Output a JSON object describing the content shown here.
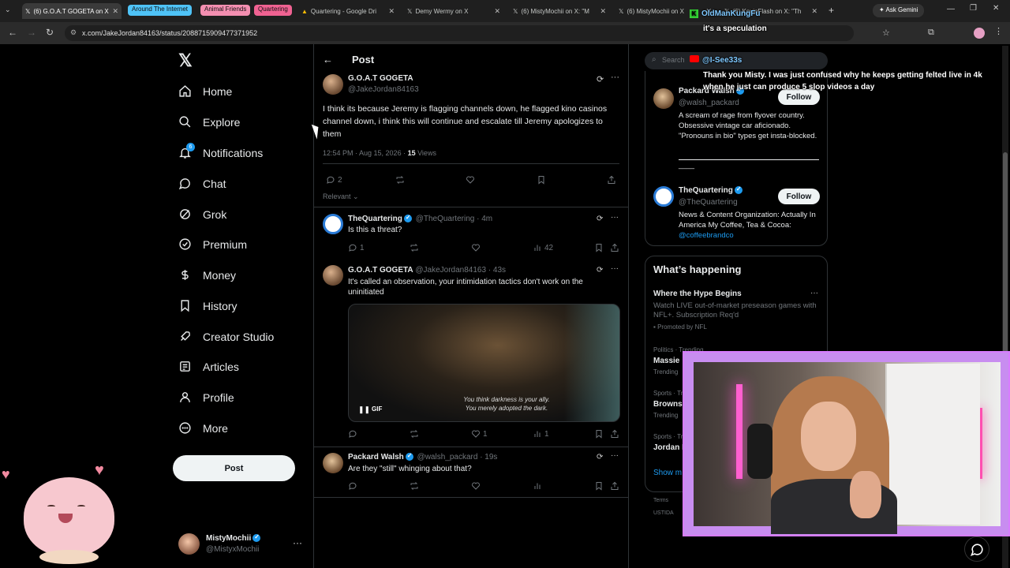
{
  "browser": {
    "tabs": [
      {
        "label": "(6) G.O.A.T GOGETA on X",
        "active": true
      },
      {
        "label": "Around The Internet",
        "group": true,
        "color": "#4fc3f7"
      },
      {
        "label": "Animal Friends",
        "group": true,
        "color": "#f48fb1"
      },
      {
        "label": "Quartering",
        "group": true,
        "color": "#f06292"
      },
      {
        "label": "Quartering - Google Dri"
      },
      {
        "label": "Demy Wermy on X"
      },
      {
        "label": "(6) MistyMochii on X: \"M"
      },
      {
        "label": "(6) MistyMochii on X"
      },
      {
        "label": "(6) KevinFlash on X: \"Th"
      }
    ],
    "ask_gemini": "Ask Gemini",
    "url": "x.com/JakeJordan84163/status/2088715909477371952"
  },
  "sidebar": {
    "items": [
      {
        "label": "Home",
        "icon": "home-icon"
      },
      {
        "label": "Explore",
        "icon": "search-icon"
      },
      {
        "label": "Notifications",
        "icon": "bell-icon"
      },
      {
        "label": "Chat",
        "icon": "chat-icon"
      },
      {
        "label": "Grok",
        "icon": "grok-icon"
      },
      {
        "label": "Premium",
        "icon": "premium-icon"
      },
      {
        "label": "Money",
        "icon": "money-icon"
      },
      {
        "label": "History",
        "icon": "bookmark-icon"
      },
      {
        "label": "Creator Studio",
        "icon": "rocket-icon"
      },
      {
        "label": "Articles",
        "icon": "article-icon"
      },
      {
        "label": "Profile",
        "icon": "person-icon"
      },
      {
        "label": "More",
        "icon": "more-circle-icon"
      }
    ],
    "notification_badge": "6",
    "post_button": "Post",
    "account": {
      "name": "MistyMochii",
      "handle": "@MistyxMochii"
    }
  },
  "header": {
    "title": "Post"
  },
  "main_post": {
    "name": "G.O.A.T GOGETA",
    "handle": "@JakeJordan84163",
    "text": "I think its because Jeremy is flagging channels down, he flagged kino casinos channel down, i think this will continue and escalate till Jeremy apologizes to them",
    "time": "12:54 PM · Aug 15, 2026 · ",
    "views_count": "15",
    "views_label": " Views",
    "replies": "2",
    "sort": "Relevant"
  },
  "replies": [
    {
      "name": "TheQuartering",
      "handle": "@TheQuartering · 4m",
      "text": "Is this a threat?",
      "replies": "1",
      "likes": "",
      "views": "42"
    },
    {
      "name": "G.O.A.T GOGETA",
      "handle": "@JakeJordan84163 · 43s",
      "text": "It's called an observation, your intimidation tactics don't work on the uninitiated",
      "gif_caption_1": "You think darkness is your ally.",
      "gif_caption_2": "You merely adopted the dark.",
      "gif_label": "GIF",
      "replies": "",
      "likes": "1",
      "views": "1"
    },
    {
      "name": "Packard Walsh",
      "handle": "@walsh_packard · 19s",
      "text": "Are they \"still\" whinging about that?"
    }
  ],
  "right": {
    "search_placeholder": "Search",
    "people": [
      {
        "name": "Packard Walsh",
        "handle": "@walsh_packard",
        "bio": "A scream of rage from flyover country. Obsessive vintage car aficionado. \"Pronouns in bio\" types get insta-blocked.",
        "extra": "____",
        "follow": "Follow"
      },
      {
        "name": "TheQuartering",
        "handle": "@TheQuartering",
        "bio": "News & Content Organization: Actually In America My Coffee, Tea & Cocoa:",
        "link": "@coffeebrandco",
        "follow": "Follow"
      }
    ],
    "whats_happening": "What’s happening",
    "trend_promo": {
      "title": "Where the Hype Begins",
      "desc": "Watch LIVE out-of-market preseason games with NFL+. Subscription Req'd",
      "promoted": "Promoted by NFL"
    },
    "trends": [
      {
        "meta": "Politics · Trending",
        "title": "Massie",
        "sub": "Trending"
      },
      {
        "meta": "Sports · Trending",
        "title": "Browns",
        "sub": "Trending"
      },
      {
        "meta": "Sports · Trending",
        "title": "Jordan I",
        "sub": ""
      }
    ],
    "show_more": "Show m",
    "footer_1": "Terms",
    "footer_2": "USTIDA"
  },
  "overlays": {
    "chat_user_1": "OldManKungFu",
    "chat_msg_1": "it's a speculation",
    "chat_user_2": "@I-See33s",
    "chat_msg_2a": "Thank you Misty. I was just confused why he keeps getting felted live in 4k",
    "chat_msg_2b": "when he just can produce 5 slop videos a day"
  },
  "colors": {
    "accent": "#1d9bf0",
    "background": "#000000",
    "border": "#2f3336",
    "muted": "#71767b"
  }
}
